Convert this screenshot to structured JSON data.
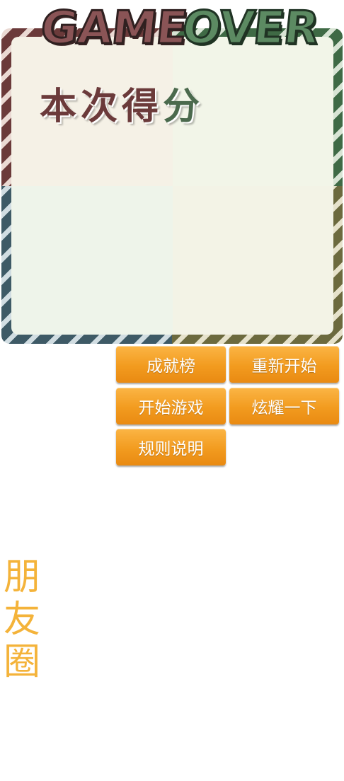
{
  "title": {
    "word1": "GAME",
    "word2": "OVER"
  },
  "score": {
    "label_part1": "本次得",
    "label_part2": "分"
  },
  "buttons": {
    "leaderboard": "成就榜",
    "restart": "重新开始",
    "start_game": "开始游戏",
    "share": "炫耀一下",
    "rules": "规则说明"
  },
  "moments": {
    "chars": [
      "朋",
      "友",
      "圈"
    ]
  },
  "colors": {
    "button_orange": "#f29b1f",
    "moments_yellow": "#f4b33a",
    "frame_brown": "#6b3a3a",
    "frame_green": "#3f6a45",
    "frame_blue": "#3e5a66",
    "frame_olive": "#6c6a3e"
  }
}
